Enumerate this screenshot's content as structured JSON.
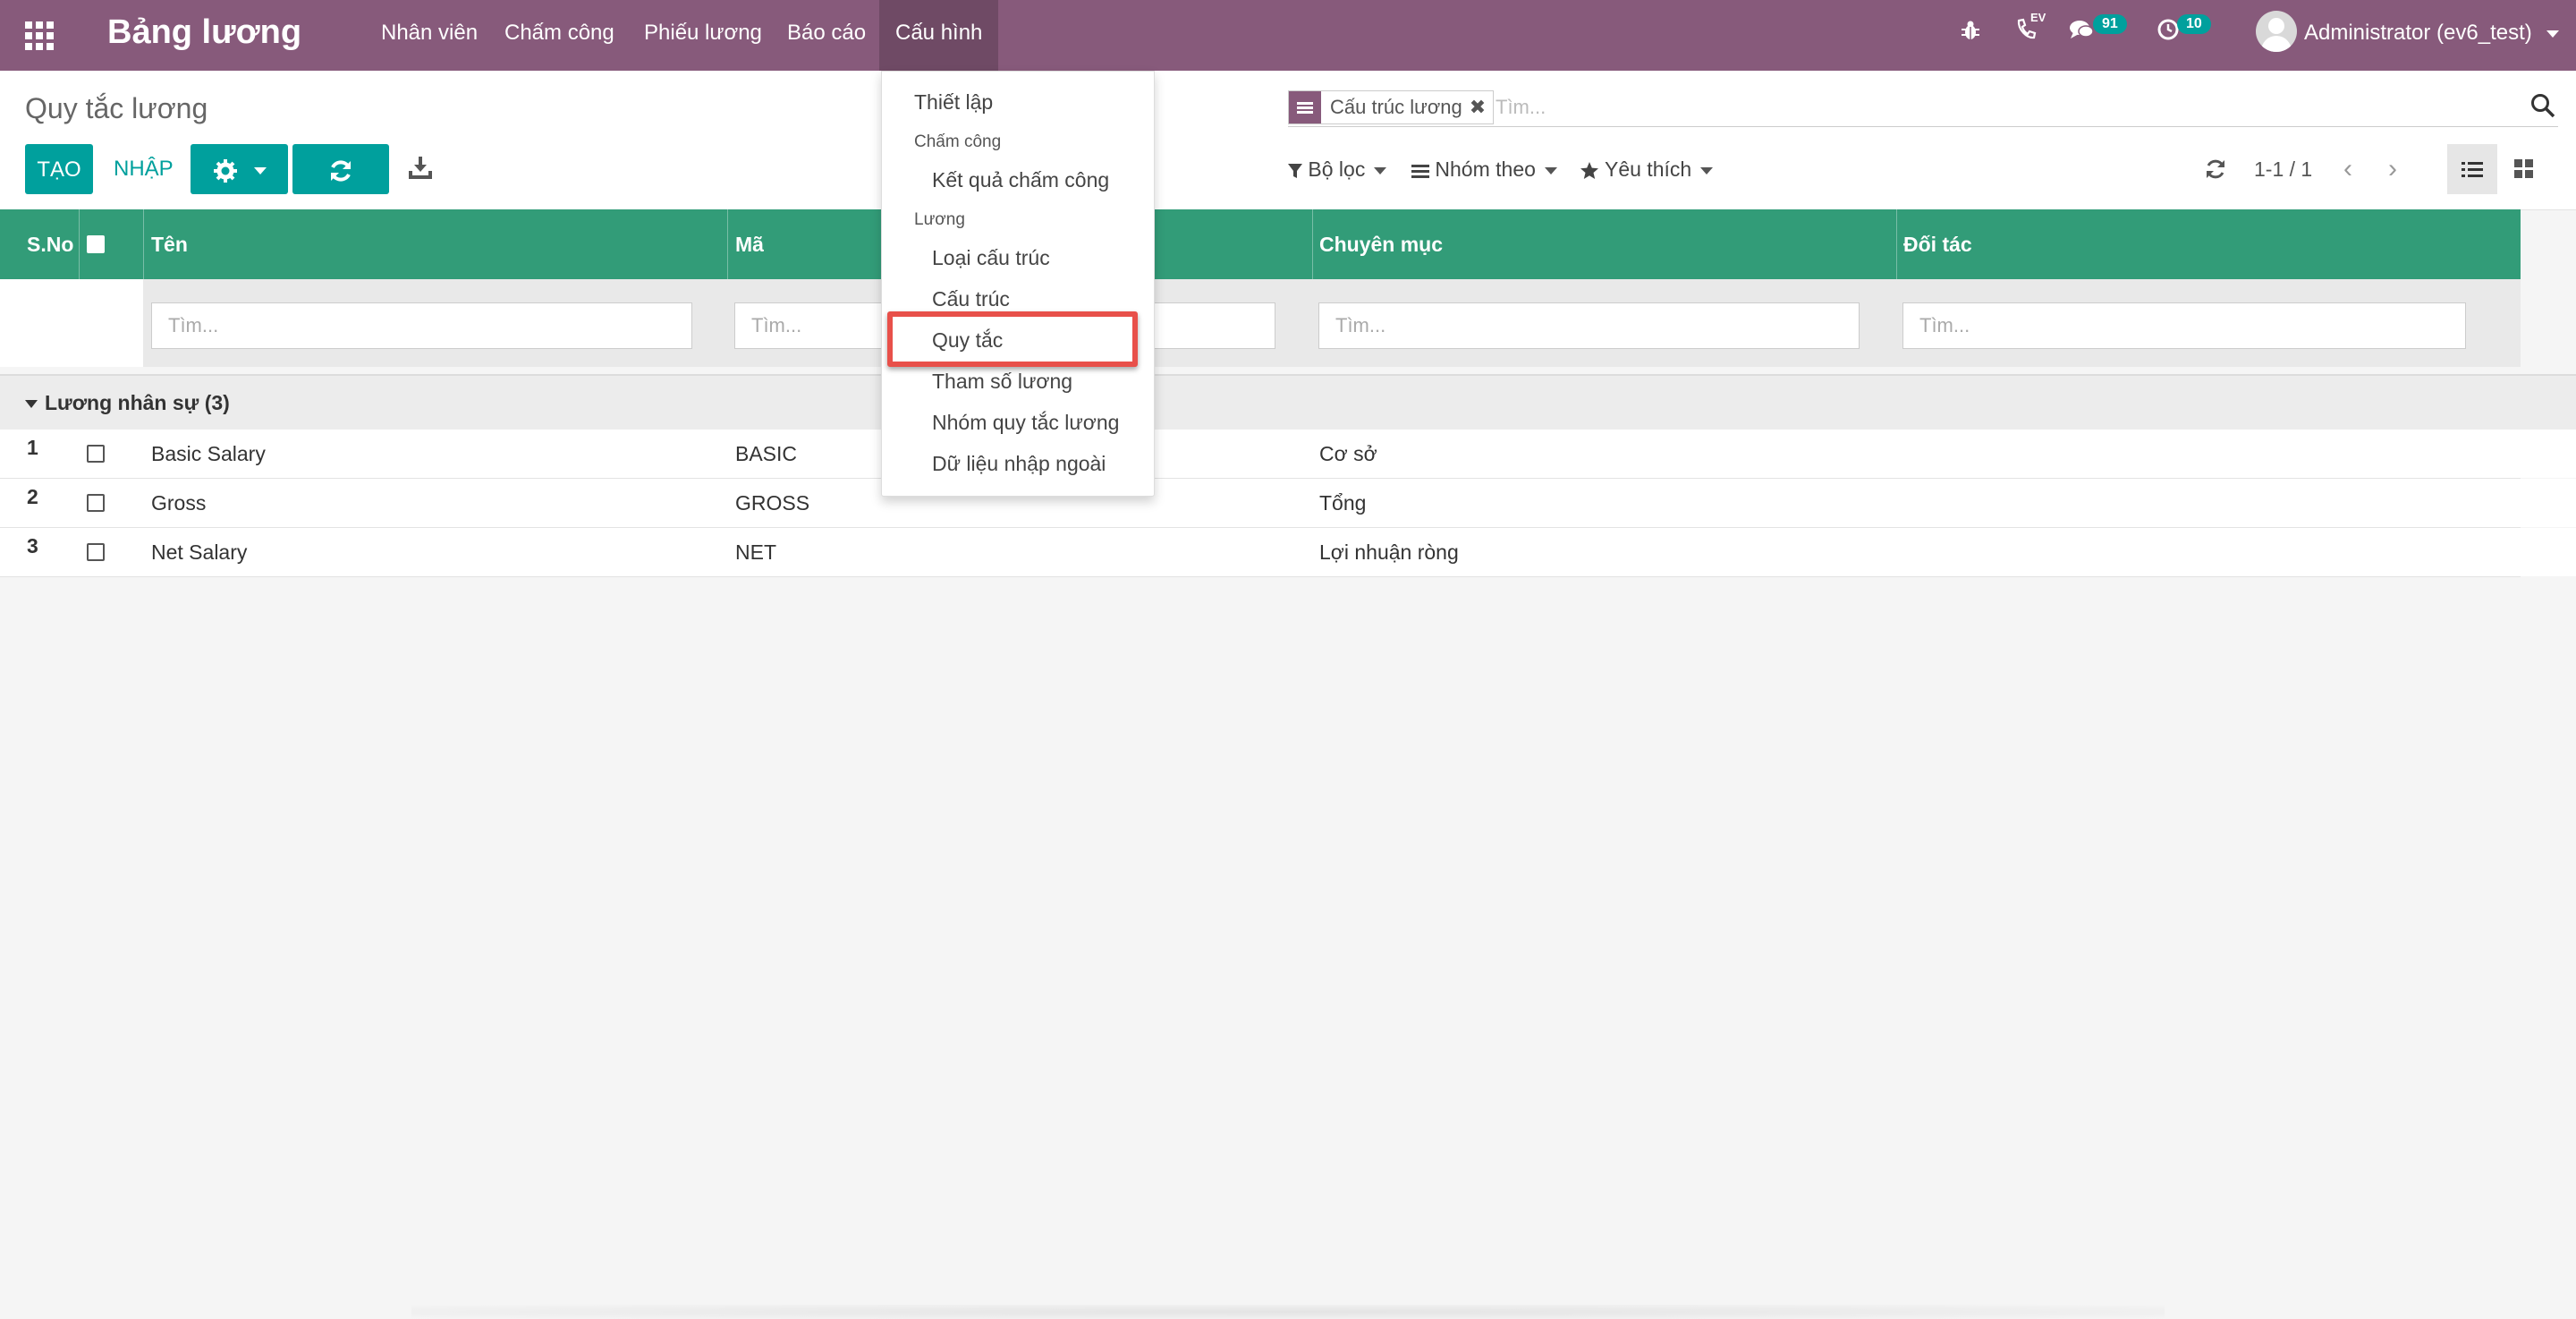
{
  "navbar": {
    "app_title": "Bảng lương",
    "menu": [
      "Nhân viên",
      "Chấm công",
      "Phiếu lương",
      "Báo cáo",
      "Cấu hình"
    ],
    "active_menu": "Cấu hình",
    "debug_icon": "bug-icon",
    "phone_label": "EV",
    "messages_count": "91",
    "activities_count": "10",
    "user": "Administrator (ev6_test)"
  },
  "control_panel": {
    "breadcrumb": "Quy tắc lương",
    "create_label": "TẠO",
    "import_label": "NHẬP",
    "search": {
      "facet_value": "Cấu trúc lương",
      "placeholder": "Tìm..."
    },
    "filters_label": "Bộ lọc",
    "group_by_label": "Nhóm theo",
    "favorites_label": "Yêu thích",
    "pager_value": "1-1 / 1"
  },
  "table": {
    "columns": [
      "S.No",
      "Tên",
      "Mã",
      "Chuyên mục",
      "Đối tác"
    ],
    "filter_placeholder": "Tìm...",
    "group_label": "Lương nhân sự (3)",
    "rows": [
      {
        "sno": "1",
        "name": "Basic Salary",
        "code": "BASIC",
        "category": "Cơ sở",
        "partner": ""
      },
      {
        "sno": "2",
        "name": "Gross",
        "code": "GROSS",
        "category": "Tổng",
        "partner": ""
      },
      {
        "sno": "3",
        "name": "Net Salary",
        "code": "NET",
        "category": "Lợi nhuận ròng",
        "partner": ""
      }
    ]
  },
  "dropdown": {
    "setup": "Thiết lập",
    "attendance_header": "Chấm công",
    "attendance_result": "Kết quả chấm công",
    "payroll_header": "Lương",
    "structure_type": "Loại cấu trúc",
    "structure": "Cấu trúc",
    "rules": "Quy tắc",
    "salary_params": "Tham số lương",
    "rule_groups": "Nhóm quy tắc lương",
    "external_data": "Dữ liệu nhập ngoài"
  },
  "colors": {
    "navbar": "#875a7b",
    "primary": "#00a09d",
    "table_header": "#329c78",
    "highlight": "#e8504a"
  }
}
